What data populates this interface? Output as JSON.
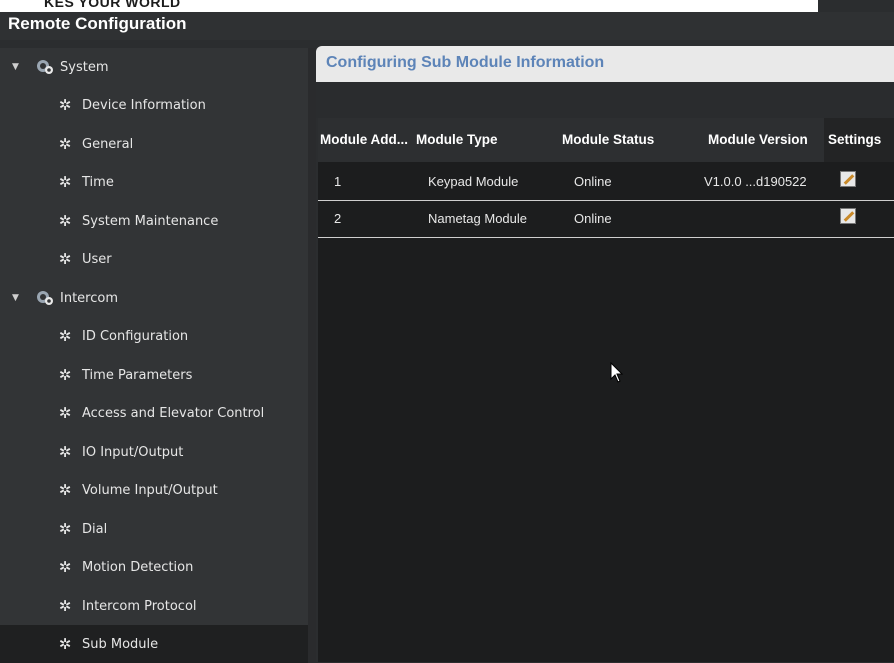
{
  "brand_text": "KES YOUR WORLD",
  "window_title": "Remote Configuration",
  "sidebar": {
    "groups": [
      {
        "label": "System",
        "items": [
          "Device Information",
          "General",
          "Time",
          "System Maintenance",
          "User"
        ]
      },
      {
        "label": "Intercom",
        "items": [
          "ID Configuration",
          "Time Parameters",
          "Access and Elevator Control",
          "IO Input/Output",
          "Volume Input/Output",
          "Dial",
          "Motion Detection",
          "Intercom Protocol",
          "Sub Module"
        ]
      }
    ],
    "selected": "Sub Module"
  },
  "panel": {
    "title": "Configuring Sub Module Information"
  },
  "table": {
    "headers": [
      "Module Add...",
      "Module Type",
      "Module Status",
      "Module Version",
      "Settings"
    ],
    "rows": [
      {
        "address": "1",
        "type": "Keypad Module",
        "status": "Online",
        "version": "V1.0.0 ...d190522"
      },
      {
        "address": "2",
        "type": "Nametag Module",
        "status": "Online",
        "version": ""
      }
    ]
  },
  "colors": {
    "accent_title": "#5d84b8",
    "edit_icon": "#c98a2a"
  }
}
